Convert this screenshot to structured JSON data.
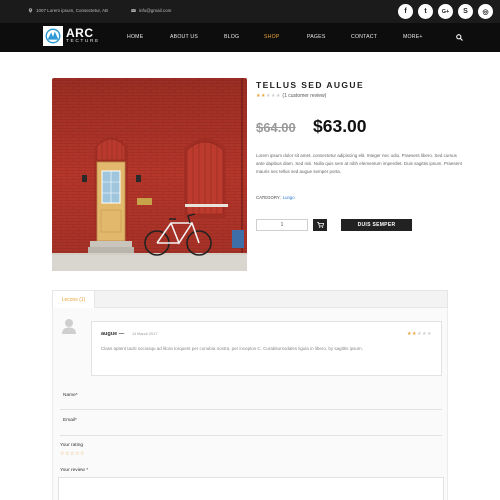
{
  "topbar": {
    "address": "1007 Lorem ipsum, Consectetur, AB",
    "email": "info@gmail.com",
    "social": [
      {
        "icon": "facebook-icon",
        "glyph": "f"
      },
      {
        "icon": "twitter-icon",
        "glyph": "t"
      },
      {
        "icon": "google-plus-icon",
        "glyph": "G+"
      },
      {
        "icon": "skype-icon",
        "glyph": "S"
      },
      {
        "icon": "instagram-icon",
        "glyph": "◎"
      }
    ]
  },
  "brand": {
    "name_top": "ARC",
    "name_bottom": "TECTURE"
  },
  "nav": {
    "items": [
      "HOME",
      "ABOUT US",
      "BLOG",
      "SHOP",
      "PAGES",
      "CONTACT",
      "MORE+"
    ],
    "active": "SHOP"
  },
  "product": {
    "title": "TELLUS SED AUGUE",
    "rating": 2,
    "rating_max": 5,
    "review_count_label": "(1 customer review)",
    "old_price": "$64.00",
    "new_price": "$63.00",
    "description": "Lorem ipsum dolor sit amet, consectetur adipiscing elit. Integer nec odio. Praesent libero. Sed cursus ante dapibus diam. Sed nisi. Nulla quis sem at nibh elementum imperdiet. Duis sagittis ipsum. Praesent mauris nec tellus sed augue semper porta.",
    "category_label": "CATEGORY:",
    "category_value": "Lungo",
    "quantity": "1",
    "buy_label": "DUIS SEMPER"
  },
  "reviews": {
    "tab_label": "Lecons (1)",
    "items": [
      {
        "author": "augue",
        "dash": "—",
        "date": "14 March 2017",
        "rating": 2,
        "text": "Class aptent taciti sociosqu ad litora torquent per conubia nostra, per inceptos C. Curabitursodales ligula in libero, by sagittis ipsum."
      }
    ],
    "form": {
      "name_label": "Name*",
      "email_label": "Email*",
      "rating_label": "Your rating",
      "review_label": "Your review *"
    }
  },
  "colors": {
    "accent": "#e8a33d",
    "topbar_bg": "#1b1b1b",
    "nav_bg": "#0d0d0d",
    "wall": "#b7372a"
  }
}
